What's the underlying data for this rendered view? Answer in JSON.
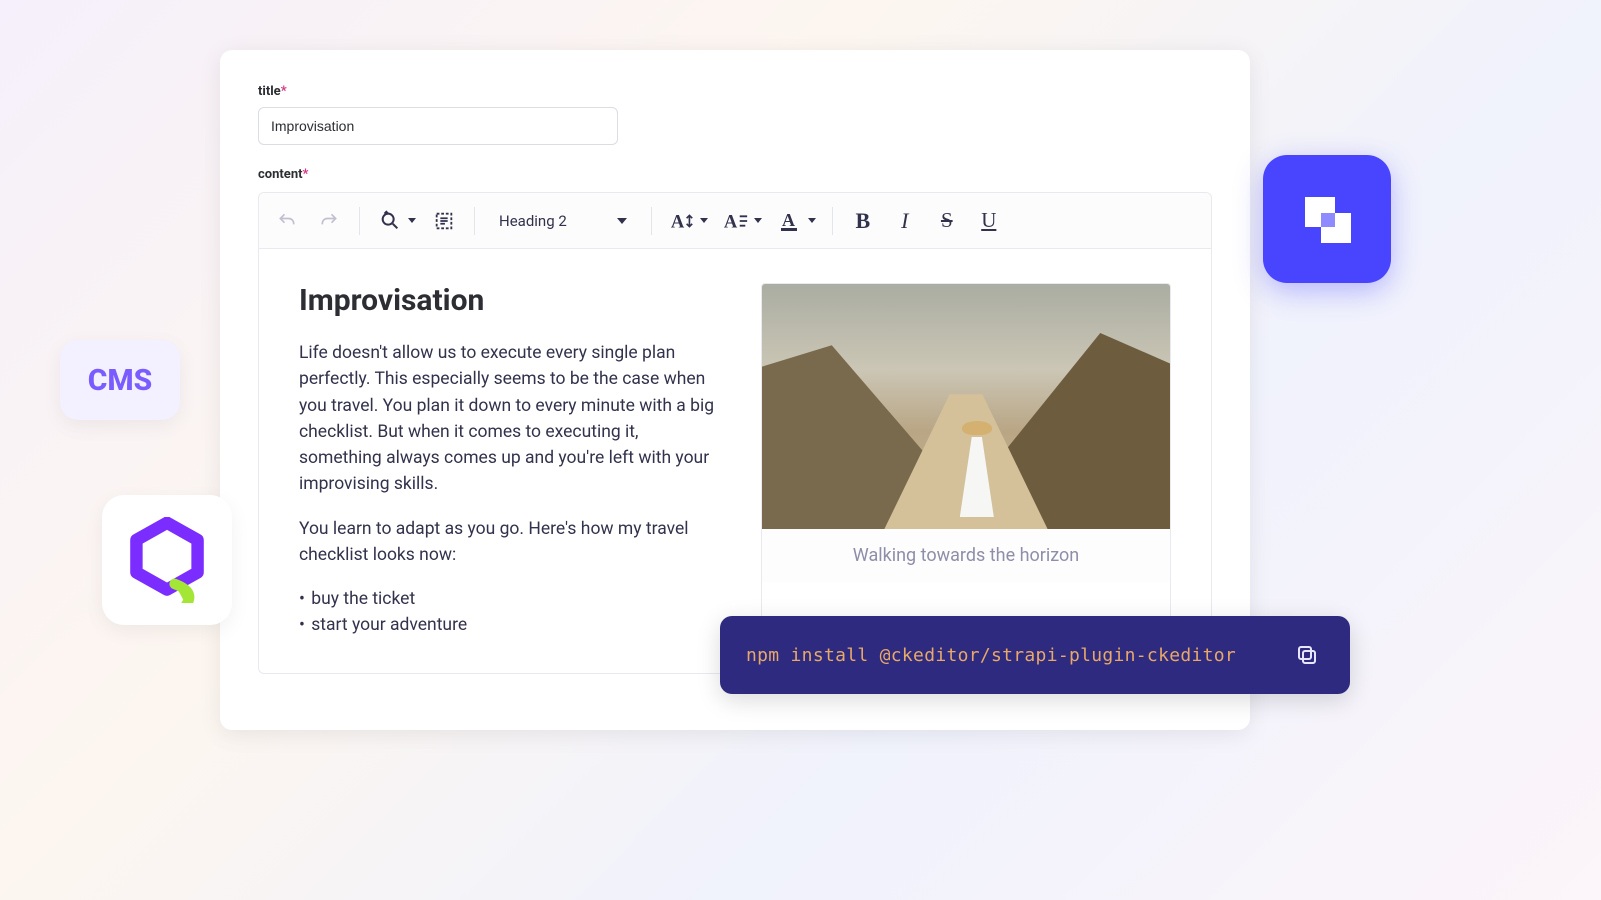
{
  "fields": {
    "title_label": "title",
    "title_value": "Improvisation",
    "content_label": "content"
  },
  "toolbar": {
    "heading": "Heading 2"
  },
  "document": {
    "heading": "Improvisation",
    "p1": "Life doesn't allow us to execute every single plan perfectly. This especially seems to be the case when you travel. You plan it down to every minute with a big checklist. But when it comes to executing it, something always comes up and you're left with your improvising skills.",
    "p2": "You learn to adapt as you go. Here's how my travel checklist looks now:",
    "bullets": [
      "buy the ticket",
      "start your adventure"
    ],
    "caption": "Walking towards the horizon"
  },
  "badges": {
    "cms": "CMS"
  },
  "install": {
    "command": "npm install @ckeditor/strapi-plugin-ckeditor"
  }
}
